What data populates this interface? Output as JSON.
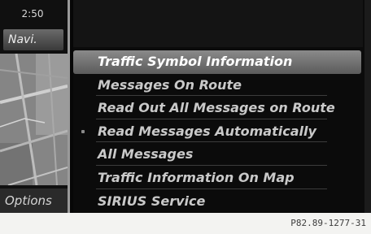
{
  "status": {
    "time": "2:50"
  },
  "sidebar": {
    "active_tab": "Navi",
    "options_label": "Options"
  },
  "menu": {
    "items": [
      {
        "label": "Traffic Symbol Information",
        "selected": true
      },
      {
        "label": "Messages On Route",
        "selected": false
      },
      {
        "label": "Read Out All Messages on Route",
        "selected": false
      },
      {
        "label": "Read Messages Automatically",
        "selected": false
      },
      {
        "label": "All Messages",
        "selected": false
      },
      {
        "label": "Traffic Information On Map",
        "selected": false
      },
      {
        "label": "SIRIUS Service",
        "selected": false
      }
    ]
  },
  "reference_code": "P82.89-1277-31",
  "colors": {
    "screen_bg": "#070707",
    "selection": "#7a7a7a",
    "text": "#c9c9c9",
    "page_bg": "#f3f3f1"
  }
}
